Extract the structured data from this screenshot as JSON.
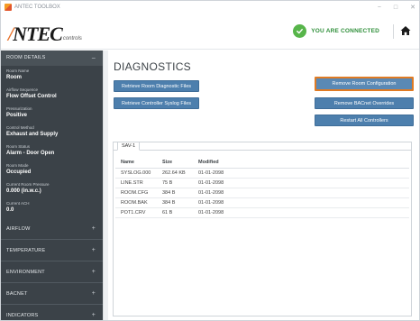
{
  "window": {
    "title": "ANTEC TOOLBOX",
    "controls": [
      "−",
      "□",
      "✕"
    ]
  },
  "header": {
    "logo_text": "NTEC",
    "logo_subtext": "controls",
    "connection_status": "YOU ARE CONNECTED",
    "status_color": "#57b54a",
    "home_icon": "home-icon"
  },
  "sidebar": {
    "room_details_label": "ROOM DETAILS",
    "fields": [
      {
        "label": "Room Name",
        "value": "Room"
      },
      {
        "label": "Airflow Sequence",
        "value": "Flow Offset Control"
      },
      {
        "label": "Pressurization",
        "value": "Positive"
      },
      {
        "label": "Control Method",
        "value": "Exhaust and Supply"
      },
      {
        "label": "Room Status",
        "value": "Alarm - Door Open"
      },
      {
        "label": "Room Mode",
        "value": "Occupied"
      },
      {
        "label": "Current Room Pressure",
        "value": "0.000 (in.w.c.)"
      },
      {
        "label": "Current ACH",
        "value": "0.0"
      }
    ],
    "sections": [
      {
        "label": "AIRFLOW"
      },
      {
        "label": "TEMPERATURE"
      },
      {
        "label": "ENVIRONMENT"
      },
      {
        "label": "BACNET"
      },
      {
        "label": "INDICATORS"
      }
    ]
  },
  "main": {
    "title": "DIAGNOSTICS",
    "buttons": {
      "retrieve_room": "Retrieve Room Diagnostic Files",
      "retrieve_syslog": "Retrieve Controller Syslog Files",
      "remove_room_config": "Remove Room Configuration",
      "remove_bacnet": "Remove BACnet Overrides",
      "restart_all": "Restart All Controllers"
    },
    "tab_label": "SAV-1",
    "columns": [
      "Name",
      "Size",
      "Modified"
    ],
    "files": [
      [
        "SYSLOG.000",
        "262.64 KB",
        "01-01-2098"
      ],
      [
        "LINE.STR",
        "75 B",
        "01-01-2098"
      ],
      [
        "ROOM.CFG",
        "384 B",
        "01-01-2098"
      ],
      [
        "ROOM.BAK",
        "384 B",
        "01-01-2098"
      ],
      [
        "POT1.CRV",
        "61 B",
        "01-01-2098"
      ]
    ]
  },
  "colors": {
    "accent_button": "#4d7fad",
    "selected_outline": "#e07b24",
    "sidebar_bg": "#3b4248"
  }
}
